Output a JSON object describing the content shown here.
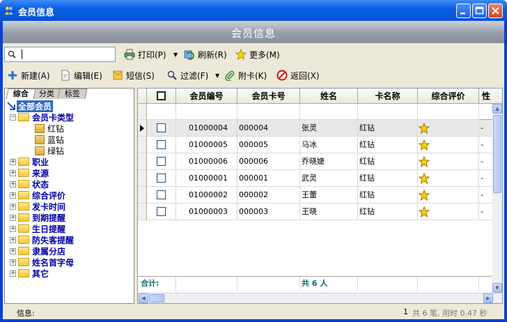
{
  "window": {
    "title": "会员信息",
    "banner_title": "会员信息"
  },
  "toolbar1": {
    "search_value": "",
    "print": "打印(P)",
    "refresh": "刷新(R)",
    "more": "更多(M)"
  },
  "toolbar2": {
    "new": "新建(A)",
    "edit": "编辑(E)",
    "sms": "短信(S)",
    "filter": "过滤(F)",
    "attach_card": "附卡(K)",
    "back": "返回(X)"
  },
  "left_tabs": [
    "综合",
    "分类",
    "标签"
  ],
  "tree": {
    "root": "全部会员",
    "card_type": "会员卡类型",
    "card_types": [
      "红钻",
      "蓝钻",
      "绿钻"
    ],
    "groups": [
      "职业",
      "来源",
      "状态",
      "综合评价",
      "发卡时间",
      "到期提醒",
      "生日提醒",
      "防失客提醒",
      "隶属分店",
      "姓名首字母",
      "其它"
    ]
  },
  "grid": {
    "columns": [
      "会员编号",
      "会员卡号",
      "姓名",
      "卡名称",
      "综合评价",
      "性"
    ],
    "rows": [
      {
        "member_no": "01000004",
        "card_no": "000004",
        "name": "张灵",
        "card_name": "红钻",
        "tail": "-"
      },
      {
        "member_no": "01000005",
        "card_no": "000005",
        "name": "马冰",
        "card_name": "红钻",
        "tail": "-"
      },
      {
        "member_no": "01000006",
        "card_no": "000006",
        "name": "乔晓婕",
        "card_name": "红钻",
        "tail": "-"
      },
      {
        "member_no": "01000001",
        "card_no": "000001",
        "name": "武灵",
        "card_name": "红钻",
        "tail": "-"
      },
      {
        "member_no": "01000002",
        "card_no": "000002",
        "name": "王蕾",
        "card_name": "红钻",
        "tail": "-"
      },
      {
        "member_no": "01000003",
        "card_no": "000003",
        "name": "王晓",
        "card_name": "红钻",
        "tail": "-"
      }
    ],
    "footer_label": "合计:",
    "footer_count": "共 6 人"
  },
  "status": {
    "info_label": "信息:",
    "page": "1",
    "summary": "共 6 笔, 用时 0.47 秒"
  },
  "colors": {
    "title_bar": "#0753d6",
    "tree_text": "#0000aa",
    "footer_text": "#0a6b7a",
    "selected": "#316ac5"
  }
}
